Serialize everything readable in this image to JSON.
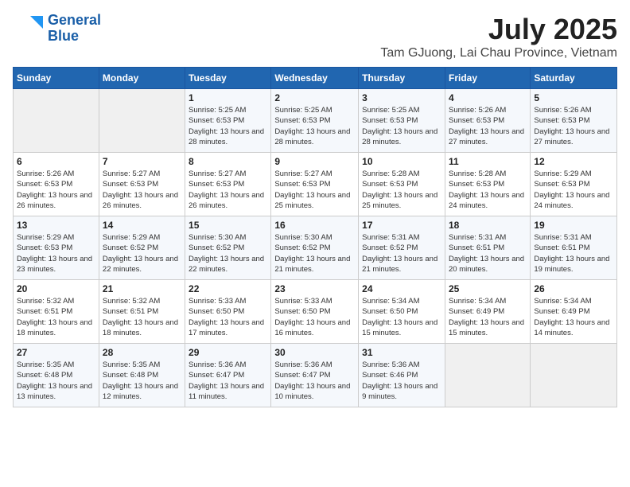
{
  "header": {
    "logo_line1": "General",
    "logo_line2": "Blue",
    "month_year": "July 2025",
    "location": "Tam GJuong, Lai Chau Province, Vietnam"
  },
  "weekdays": [
    "Sunday",
    "Monday",
    "Tuesday",
    "Wednesday",
    "Thursday",
    "Friday",
    "Saturday"
  ],
  "weeks": [
    [
      {
        "day": "",
        "info": ""
      },
      {
        "day": "",
        "info": ""
      },
      {
        "day": "1",
        "info": "Sunrise: 5:25 AM\nSunset: 6:53 PM\nDaylight: 13 hours and 28 minutes."
      },
      {
        "day": "2",
        "info": "Sunrise: 5:25 AM\nSunset: 6:53 PM\nDaylight: 13 hours and 28 minutes."
      },
      {
        "day": "3",
        "info": "Sunrise: 5:25 AM\nSunset: 6:53 PM\nDaylight: 13 hours and 28 minutes."
      },
      {
        "day": "4",
        "info": "Sunrise: 5:26 AM\nSunset: 6:53 PM\nDaylight: 13 hours and 27 minutes."
      },
      {
        "day": "5",
        "info": "Sunrise: 5:26 AM\nSunset: 6:53 PM\nDaylight: 13 hours and 27 minutes."
      }
    ],
    [
      {
        "day": "6",
        "info": "Sunrise: 5:26 AM\nSunset: 6:53 PM\nDaylight: 13 hours and 26 minutes."
      },
      {
        "day": "7",
        "info": "Sunrise: 5:27 AM\nSunset: 6:53 PM\nDaylight: 13 hours and 26 minutes."
      },
      {
        "day": "8",
        "info": "Sunrise: 5:27 AM\nSunset: 6:53 PM\nDaylight: 13 hours and 26 minutes."
      },
      {
        "day": "9",
        "info": "Sunrise: 5:27 AM\nSunset: 6:53 PM\nDaylight: 13 hours and 25 minutes."
      },
      {
        "day": "10",
        "info": "Sunrise: 5:28 AM\nSunset: 6:53 PM\nDaylight: 13 hours and 25 minutes."
      },
      {
        "day": "11",
        "info": "Sunrise: 5:28 AM\nSunset: 6:53 PM\nDaylight: 13 hours and 24 minutes."
      },
      {
        "day": "12",
        "info": "Sunrise: 5:29 AM\nSunset: 6:53 PM\nDaylight: 13 hours and 24 minutes."
      }
    ],
    [
      {
        "day": "13",
        "info": "Sunrise: 5:29 AM\nSunset: 6:53 PM\nDaylight: 13 hours and 23 minutes."
      },
      {
        "day": "14",
        "info": "Sunrise: 5:29 AM\nSunset: 6:52 PM\nDaylight: 13 hours and 22 minutes."
      },
      {
        "day": "15",
        "info": "Sunrise: 5:30 AM\nSunset: 6:52 PM\nDaylight: 13 hours and 22 minutes."
      },
      {
        "day": "16",
        "info": "Sunrise: 5:30 AM\nSunset: 6:52 PM\nDaylight: 13 hours and 21 minutes."
      },
      {
        "day": "17",
        "info": "Sunrise: 5:31 AM\nSunset: 6:52 PM\nDaylight: 13 hours and 21 minutes."
      },
      {
        "day": "18",
        "info": "Sunrise: 5:31 AM\nSunset: 6:51 PM\nDaylight: 13 hours and 20 minutes."
      },
      {
        "day": "19",
        "info": "Sunrise: 5:31 AM\nSunset: 6:51 PM\nDaylight: 13 hours and 19 minutes."
      }
    ],
    [
      {
        "day": "20",
        "info": "Sunrise: 5:32 AM\nSunset: 6:51 PM\nDaylight: 13 hours and 18 minutes."
      },
      {
        "day": "21",
        "info": "Sunrise: 5:32 AM\nSunset: 6:51 PM\nDaylight: 13 hours and 18 minutes."
      },
      {
        "day": "22",
        "info": "Sunrise: 5:33 AM\nSunset: 6:50 PM\nDaylight: 13 hours and 17 minutes."
      },
      {
        "day": "23",
        "info": "Sunrise: 5:33 AM\nSunset: 6:50 PM\nDaylight: 13 hours and 16 minutes."
      },
      {
        "day": "24",
        "info": "Sunrise: 5:34 AM\nSunset: 6:50 PM\nDaylight: 13 hours and 15 minutes."
      },
      {
        "day": "25",
        "info": "Sunrise: 5:34 AM\nSunset: 6:49 PM\nDaylight: 13 hours and 15 minutes."
      },
      {
        "day": "26",
        "info": "Sunrise: 5:34 AM\nSunset: 6:49 PM\nDaylight: 13 hours and 14 minutes."
      }
    ],
    [
      {
        "day": "27",
        "info": "Sunrise: 5:35 AM\nSunset: 6:48 PM\nDaylight: 13 hours and 13 minutes."
      },
      {
        "day": "28",
        "info": "Sunrise: 5:35 AM\nSunset: 6:48 PM\nDaylight: 13 hours and 12 minutes."
      },
      {
        "day": "29",
        "info": "Sunrise: 5:36 AM\nSunset: 6:47 PM\nDaylight: 13 hours and 11 minutes."
      },
      {
        "day": "30",
        "info": "Sunrise: 5:36 AM\nSunset: 6:47 PM\nDaylight: 13 hours and 10 minutes."
      },
      {
        "day": "31",
        "info": "Sunrise: 5:36 AM\nSunset: 6:46 PM\nDaylight: 13 hours and 9 minutes."
      },
      {
        "day": "",
        "info": ""
      },
      {
        "day": "",
        "info": ""
      }
    ]
  ]
}
